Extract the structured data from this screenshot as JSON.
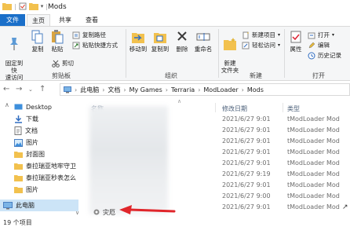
{
  "window": {
    "title": "Mods"
  },
  "tabs": {
    "file": "文件",
    "home": "主页",
    "share": "共享",
    "view": "查看"
  },
  "ribbon": {
    "pin_quick_access": "固定到快\n速访问",
    "copy": "复制",
    "paste": "粘贴",
    "copy_path": "复制路径",
    "paste_shortcut": "粘贴快捷方式",
    "cut": "剪切",
    "group_clipboard": "剪贴板",
    "move_to": "移动到",
    "copy_to": "复制到",
    "delete": "删除",
    "rename": "重命名",
    "group_organize": "组织",
    "new_folder": "新建\n文件夹",
    "new_item": "新建项目",
    "easy_access": "轻松访问",
    "group_new": "新建",
    "properties": "属性",
    "open": "打开",
    "edit": "编辑",
    "history": "历史记录",
    "group_open": "打开"
  },
  "address": {
    "crumbs": [
      "此电脑",
      "文档",
      "My Games",
      "Terraria",
      "ModLoader",
      "Mods"
    ]
  },
  "nav": {
    "items": [
      {
        "label": "Desktop",
        "pinned": true
      },
      {
        "label": "下载",
        "pinned": true
      },
      {
        "label": "文档",
        "pinned": true
      },
      {
        "label": "图片",
        "pinned": true
      },
      {
        "label": "封面图",
        "pinned": false
      },
      {
        "label": "泰拉瑞亚地牢守卫",
        "pinned": false
      },
      {
        "label": "泰拉瑞亚秒表怎么",
        "pinned": false
      },
      {
        "label": "图片",
        "pinned": false
      },
      {
        "label": "此电脑",
        "pinned": false
      }
    ]
  },
  "columns": {
    "name": "名称",
    "date": "修改日期",
    "type": "类型"
  },
  "files": [
    {
      "date": "2021/6/27 9:01",
      "type": "tModLoader Mod"
    },
    {
      "date": "2021/6/27 9:01",
      "type": "tModLoader Mod"
    },
    {
      "date": "2021/6/27 9:01",
      "type": "tModLoader Mod"
    },
    {
      "date": "2021/6/27 9:01",
      "type": "tModLoader Mod"
    },
    {
      "date": "2021/6/27 9:01",
      "type": "tModLoader Mod"
    },
    {
      "date": "2021/6/27 9:19",
      "type": "tModLoader Mod"
    },
    {
      "date": "2021/6/27 9:01",
      "type": "tModLoader Mod"
    },
    {
      "date": "2021/6/27 9:00",
      "type": "tModLoader Mod"
    },
    {
      "date": "2021/6/27 9:01",
      "type": "tModLoader Mod"
    }
  ],
  "highlighted_file": {
    "name": "灾厄",
    "date": "2021/6/27 9:01",
    "type": "tModLoader Mod"
  },
  "status": {
    "count": "19 个项目"
  },
  "colors": {
    "accent": "#1a6fc9",
    "arrow": "#e0262b",
    "folder": "#f2c14e"
  }
}
